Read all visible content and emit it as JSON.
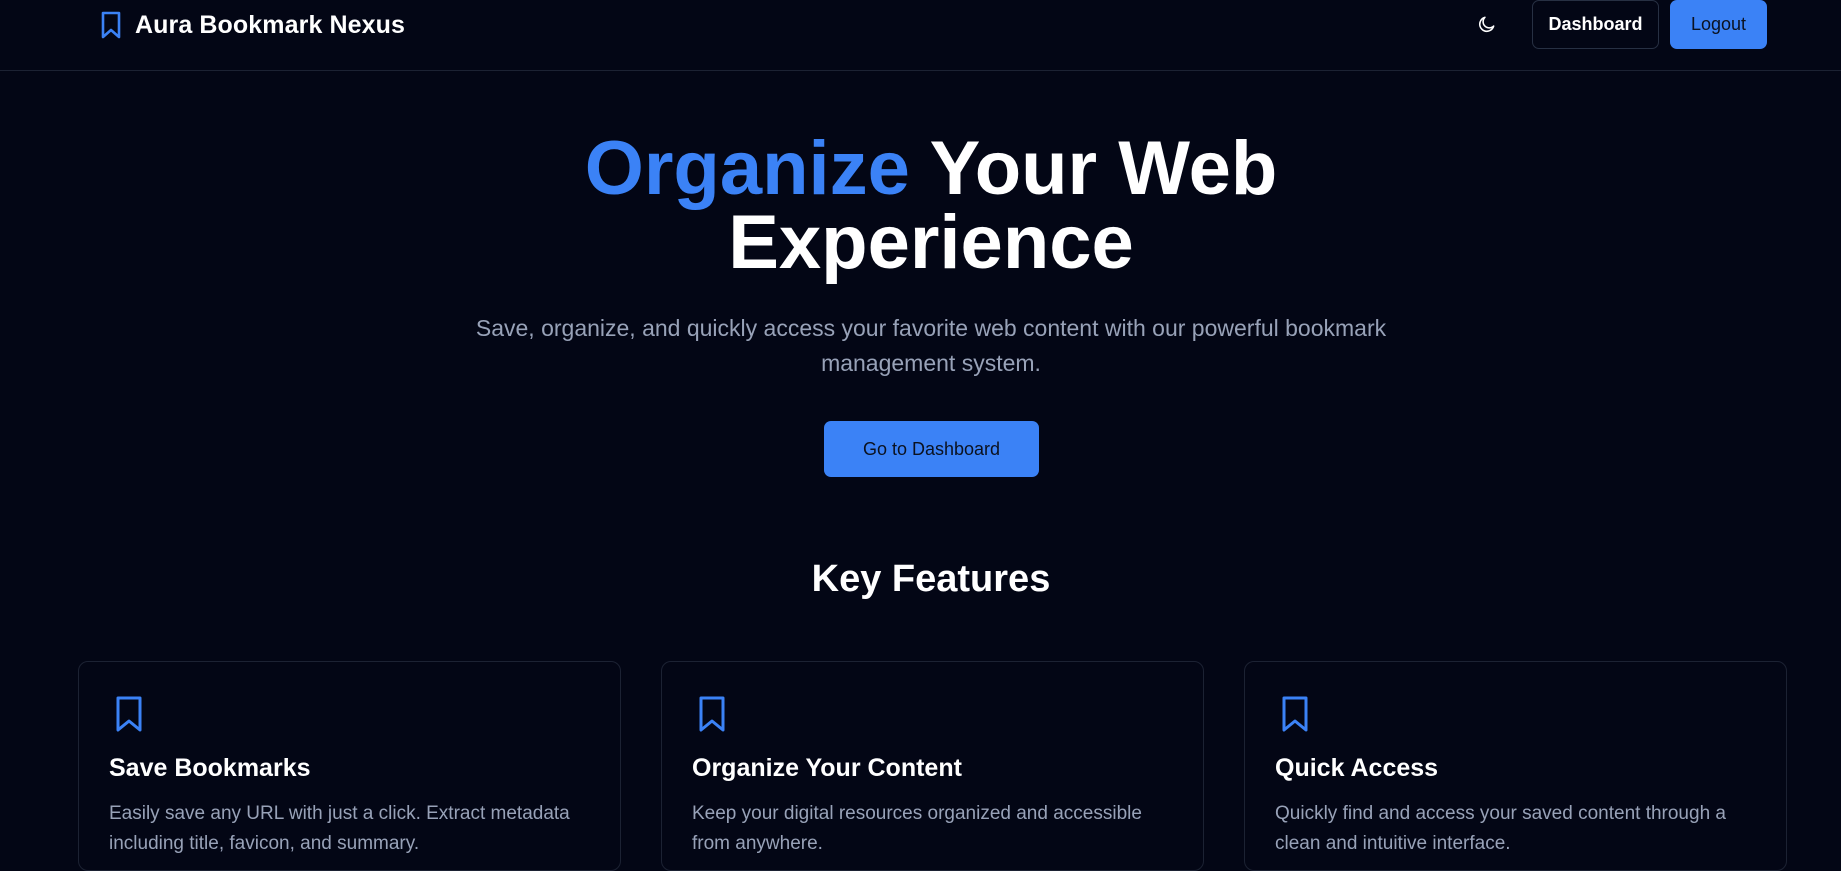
{
  "header": {
    "brand_name": "Aura Bookmark Nexus",
    "brand_icon": "bookmark-icon",
    "theme_icon": "moon-icon",
    "dashboard_label": "Dashboard",
    "logout_label": "Logout"
  },
  "hero": {
    "title_accent": "Organize",
    "title_rest": "Your Web",
    "title_line2": "Experience",
    "subtitle_line1": "Save, organize, and quickly access your favorite web content with our powerful bookmark",
    "subtitle_line2": "management system.",
    "cta_label": "Go to Dashboard"
  },
  "features": {
    "title": "Key Features",
    "cards": [
      {
        "icon": "bookmark-icon",
        "title": "Save Bookmarks",
        "desc_line1": "Easily save any URL with just a click. Extract metadata",
        "desc_line2": "including title, favicon, and summary."
      },
      {
        "icon": "bookmark-icon",
        "title": "Organize Your Content",
        "desc_line1": "Keep your digital resources organized and accessible",
        "desc_line2": "from anywhere."
      },
      {
        "icon": "bookmark-icon",
        "title": "Quick Access",
        "desc_line1": "Quickly find and access your saved content through a",
        "desc_line2": "clean and intuitive interface."
      }
    ]
  },
  "colors": {
    "background": "#030615",
    "accent": "#3b82f6",
    "muted_text": "#98a2b8",
    "border": "#1c2233"
  }
}
